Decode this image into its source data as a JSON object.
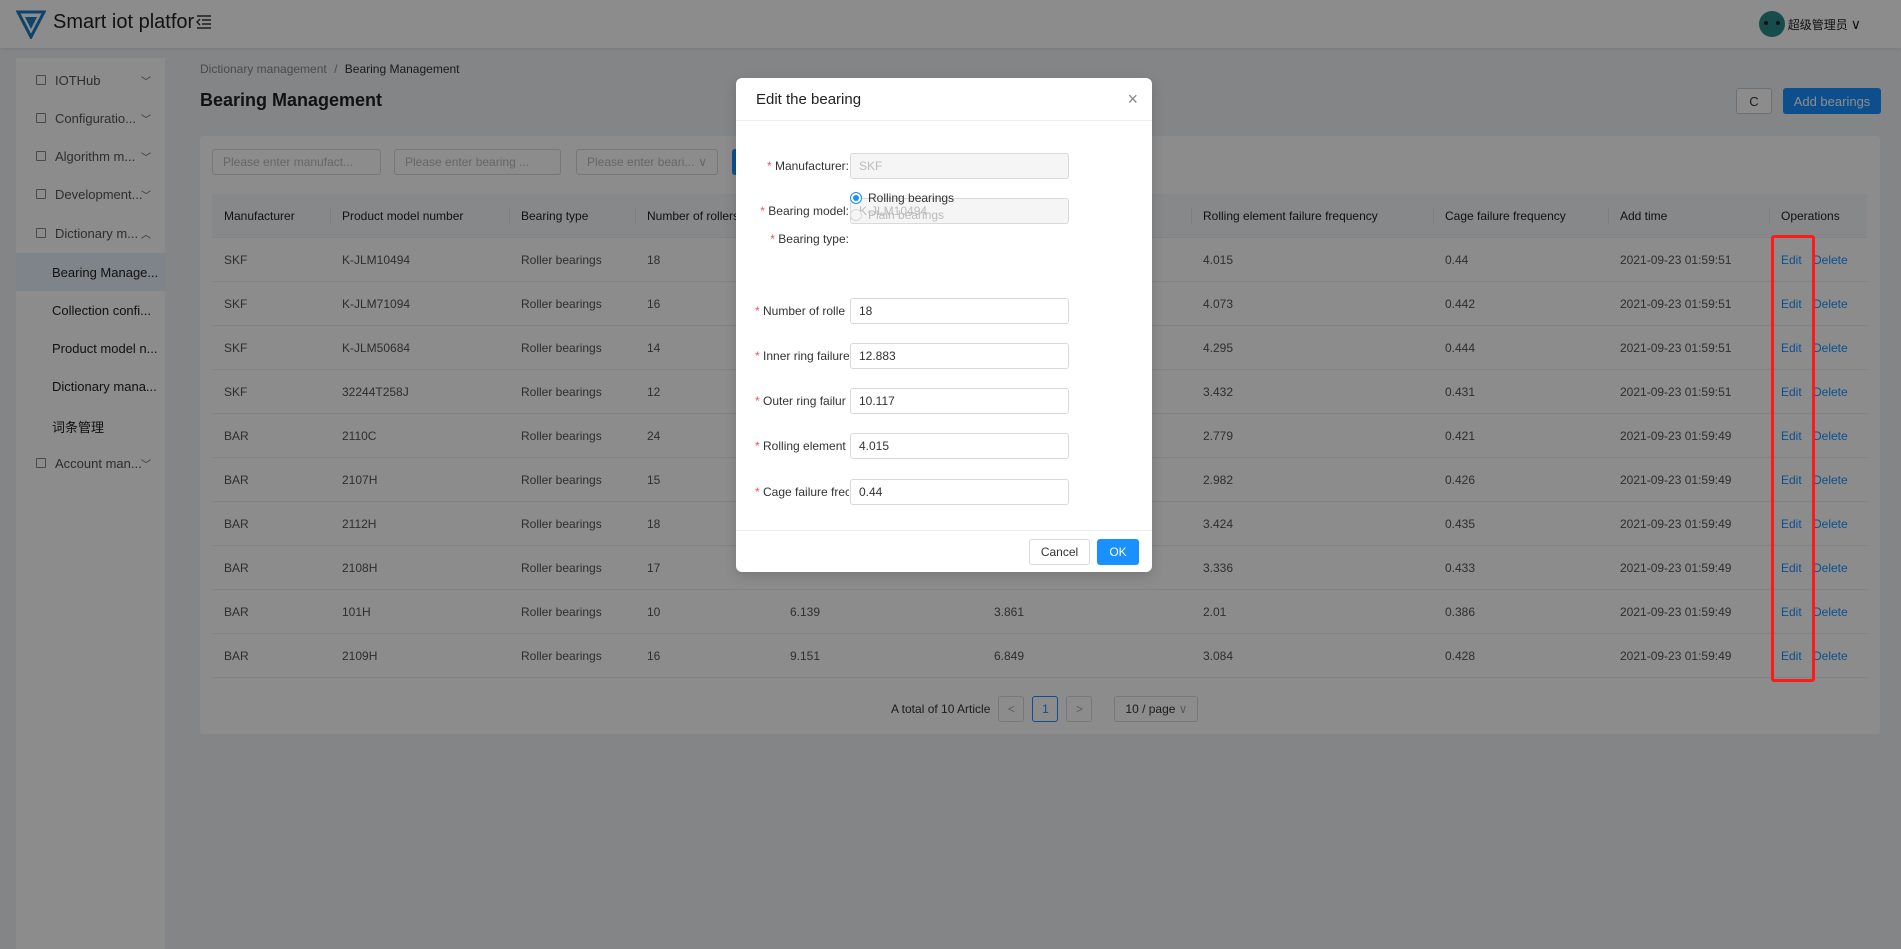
{
  "app": {
    "title": "Smart iot platfor",
    "user": "超级管理员"
  },
  "sidebar": {
    "items": [
      {
        "label": "IOTHub",
        "chevron": "chevron-down",
        "icon": "grid-icon"
      },
      {
        "label": "Configuratio...",
        "chevron": "chevron-down",
        "icon": "config-icon"
      },
      {
        "label": "Algorithm m...",
        "chevron": "chevron-down",
        "icon": "algorithm-icon"
      },
      {
        "label": "Development...",
        "chevron": "chevron-down",
        "icon": "development-icon"
      },
      {
        "label": "Dictionary m...",
        "chevron": "chevron-up",
        "icon": "book-icon"
      },
      {
        "label": "Bearing Manage...",
        "sub": true,
        "active": true
      },
      {
        "label": "Collection confi...",
        "sub": true
      },
      {
        "label": "Product model n...",
        "sub": true
      },
      {
        "label": "Dictionary mana...",
        "sub": true
      },
      {
        "label": "词条管理",
        "sub": true
      },
      {
        "label": "Account man...",
        "chevron": "chevron-down",
        "icon": "account-icon"
      }
    ]
  },
  "breadcrumb": {
    "parent": "Dictionary management",
    "separator": "/",
    "current": "Bearing Management"
  },
  "page": {
    "title": "Bearing Management",
    "refresh_icon": "C",
    "add_label": "Add bearings"
  },
  "filters": {
    "manufacturer_placeholder": "Please enter manufact...",
    "model_placeholder": "Please enter bearing ...",
    "type_placeholder": "Please enter beari..."
  },
  "table": {
    "headers": [
      "Manufacturer",
      "Product model number",
      "Bearing type",
      "Number of rollers",
      "",
      "",
      "Rolling element failure frequency",
      "Cage failure frequency",
      "Add time",
      "Operations"
    ],
    "rows": [
      [
        "SKF",
        "K-JLM10494",
        "Roller bearings",
        "18",
        null,
        null,
        "4.015",
        "0.44",
        "2021-09-23 01:59:51"
      ],
      [
        "SKF",
        "K-JLM71094",
        "Roller bearings",
        "16",
        null,
        null,
        "4.073",
        "0.442",
        "2021-09-23 01:59:51"
      ],
      [
        "SKF",
        "K-JLM50684",
        "Roller bearings",
        "14",
        null,
        null,
        "4.295",
        "0.444",
        "2021-09-23 01:59:51"
      ],
      [
        "SKF",
        "32244T258J",
        "Roller bearings",
        "12",
        null,
        null,
        "3.432",
        "0.431",
        "2021-09-23 01:59:51"
      ],
      [
        "BAR",
        "2110C",
        "Roller bearings",
        "24",
        null,
        null,
        "2.779",
        "0.421",
        "2021-09-23 01:59:49"
      ],
      [
        "BAR",
        "2107H",
        "Roller bearings",
        "15",
        null,
        null,
        "2.982",
        "0.426",
        "2021-09-23 01:59:49"
      ],
      [
        "BAR",
        "2112H",
        "Roller bearings",
        "18",
        null,
        null,
        "3.424",
        "0.435",
        "2021-09-23 01:59:49"
      ],
      [
        "BAR",
        "2108H",
        "Roller bearings",
        "17",
        null,
        null,
        "3.336",
        "0.433",
        "2021-09-23 01:59:49"
      ],
      [
        "BAR",
        "101H",
        "Roller bearings",
        "10",
        "6.139",
        "3.861",
        "2.01",
        "0.386",
        "2021-09-23 01:59:49"
      ],
      [
        "BAR",
        "2109H",
        "Roller bearings",
        "16",
        "9.151",
        "6.849",
        "3.084",
        "0.428",
        "2021-09-23 01:59:49"
      ]
    ],
    "edit_label": "Edit",
    "delete_label": "Delete"
  },
  "pagination": {
    "total": "A total of 10 Article",
    "prev": "<",
    "page": "1",
    "next": ">",
    "page_size": "10 / page"
  },
  "modal": {
    "title": "Edit the bearing",
    "close": "×",
    "fields": [
      {
        "label": "Manufacturer:",
        "value": "SKF",
        "disabled": true
      },
      {
        "label": "Bearing model:",
        "value": "K-JLM10494",
        "disabled": true
      },
      {
        "label": "Number of rolle",
        "value": "18"
      },
      {
        "label": "Inner ring failure",
        "value": "12.883"
      },
      {
        "label": "Outer ring failur",
        "value": "10.117"
      },
      {
        "label": "Rolling element",
        "value": "4.015"
      },
      {
        "label": "Cage failure frec",
        "value": "0.44"
      }
    ],
    "bearing_type": {
      "label": "Bearing type:",
      "options": [
        "Rolling bearings",
        "Plain bearings"
      ],
      "selected": "Rolling bearings"
    },
    "cancel": "Cancel",
    "ok": "OK"
  },
  "colors": {
    "primary": "#1890ff",
    "highlight": "#ff1a1a",
    "required": "#ff4d4f"
  }
}
